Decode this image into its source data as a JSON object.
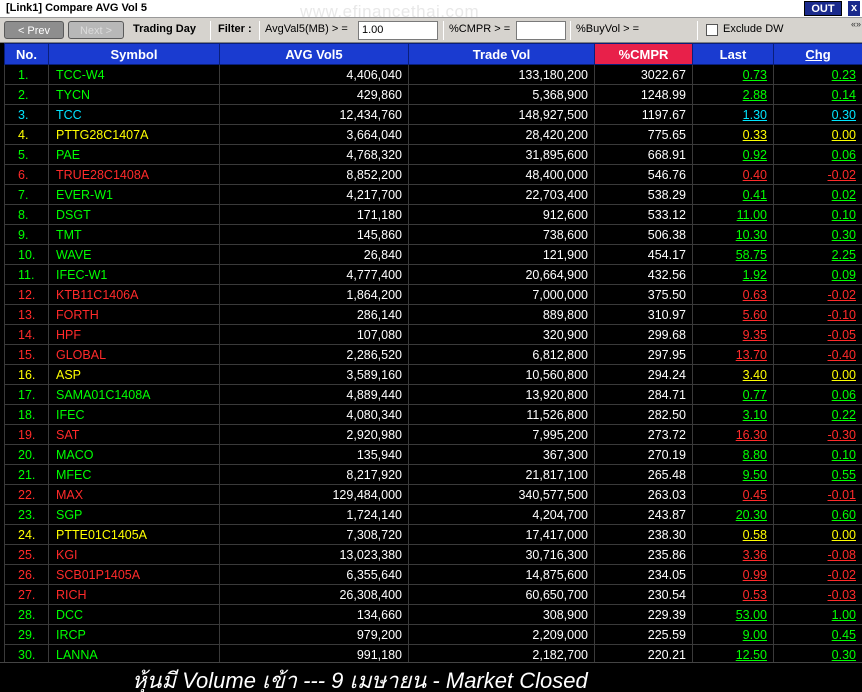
{
  "window": {
    "title": "[Link1] Compare AVG Vol 5",
    "out_label": "OUT",
    "close_label": "x"
  },
  "watermark": "www.efinancethai.com",
  "toolbar": {
    "prev_label": "< Prev",
    "next_label": "Next >",
    "trading_day_label": "Trading Day",
    "filter_label": "Filter :",
    "avgvol_label": "AvgVal5(MB) > =",
    "avgvol_value": "1.00",
    "cmpr_label": "%CMPR > =",
    "cmpr_value": "",
    "buyvol_label": "%BuyVol > =",
    "exclude_dw_label": "Exclude DW",
    "scroll_arrows": "«»"
  },
  "columns": [
    "No.",
    "Symbol",
    "AVG Vol5",
    "Trade Vol",
    "%CMPR",
    "Last",
    "Chg"
  ],
  "colors": {
    "green": "#00ff00",
    "cyan": "#00e5ff",
    "yellow": "#ffff00",
    "red": "#ff2a2a",
    "header_blue": "#1a3bd0",
    "header_highlight": "#e8204a"
  },
  "rows": [
    {
      "no": "1.",
      "symbol": "TCC-W4",
      "avg": "4,406,040",
      "trade": "133,180,200",
      "cmpr": "3022.67",
      "last": "0.73",
      "chg": "0.23",
      "color": "green"
    },
    {
      "no": "2.",
      "symbol": "TYCN",
      "avg": "429,860",
      "trade": "5,368,900",
      "cmpr": "1248.99",
      "last": "2.88",
      "chg": "0.14",
      "color": "green"
    },
    {
      "no": "3.",
      "symbol": "TCC",
      "avg": "12,434,760",
      "trade": "148,927,500",
      "cmpr": "1197.67",
      "last": "1.30",
      "chg": "0.30",
      "color": "cyan"
    },
    {
      "no": "4.",
      "symbol": "PTTG28C1407A",
      "avg": "3,664,040",
      "trade": "28,420,200",
      "cmpr": "775.65",
      "last": "0.33",
      "chg": "0.00",
      "color": "yellow"
    },
    {
      "no": "5.",
      "symbol": "PAE",
      "avg": "4,768,320",
      "trade": "31,895,600",
      "cmpr": "668.91",
      "last": "0.92",
      "chg": "0.06",
      "color": "green"
    },
    {
      "no": "6.",
      "symbol": "TRUE28C1408A",
      "avg": "8,852,200",
      "trade": "48,400,000",
      "cmpr": "546.76",
      "last": "0.40",
      "chg": "-0.02",
      "color": "red"
    },
    {
      "no": "7.",
      "symbol": "EVER-W1",
      "avg": "4,217,700",
      "trade": "22,703,400",
      "cmpr": "538.29",
      "last": "0.41",
      "chg": "0.02",
      "color": "green"
    },
    {
      "no": "8.",
      "symbol": "DSGT",
      "avg": "171,180",
      "trade": "912,600",
      "cmpr": "533.12",
      "last": "11.00",
      "chg": "0.10",
      "color": "green"
    },
    {
      "no": "9.",
      "symbol": "TMT",
      "avg": "145,860",
      "trade": "738,600",
      "cmpr": "506.38",
      "last": "10.30",
      "chg": "0.30",
      "color": "green"
    },
    {
      "no": "10.",
      "symbol": "WAVE",
      "avg": "26,840",
      "trade": "121,900",
      "cmpr": "454.17",
      "last": "58.75",
      "chg": "2.25",
      "color": "green"
    },
    {
      "no": "11.",
      "symbol": "IFEC-W1",
      "avg": "4,777,400",
      "trade": "20,664,900",
      "cmpr": "432.56",
      "last": "1.92",
      "chg": "0.09",
      "color": "green"
    },
    {
      "no": "12.",
      "symbol": "KTB11C1406A",
      "avg": "1,864,200",
      "trade": "7,000,000",
      "cmpr": "375.50",
      "last": "0.63",
      "chg": "-0.02",
      "color": "red"
    },
    {
      "no": "13.",
      "symbol": "FORTH",
      "avg": "286,140",
      "trade": "889,800",
      "cmpr": "310.97",
      "last": "5.60",
      "chg": "-0.10",
      "color": "red"
    },
    {
      "no": "14.",
      "symbol": "HPF",
      "avg": "107,080",
      "trade": "320,900",
      "cmpr": "299.68",
      "last": "9.35",
      "chg": "-0.05",
      "color": "red"
    },
    {
      "no": "15.",
      "symbol": "GLOBAL",
      "avg": "2,286,520",
      "trade": "6,812,800",
      "cmpr": "297.95",
      "last": "13.70",
      "chg": "-0.40",
      "color": "red"
    },
    {
      "no": "16.",
      "symbol": "ASP",
      "avg": "3,589,160",
      "trade": "10,560,800",
      "cmpr": "294.24",
      "last": "3.40",
      "chg": "0.00",
      "color": "yellow"
    },
    {
      "no": "17.",
      "symbol": "SAMA01C1408A",
      "avg": "4,889,440",
      "trade": "13,920,800",
      "cmpr": "284.71",
      "last": "0.77",
      "chg": "0.06",
      "color": "green"
    },
    {
      "no": "18.",
      "symbol": "IFEC",
      "avg": "4,080,340",
      "trade": "11,526,800",
      "cmpr": "282.50",
      "last": "3.10",
      "chg": "0.22",
      "color": "green"
    },
    {
      "no": "19.",
      "symbol": "SAT",
      "avg": "2,920,980",
      "trade": "7,995,200",
      "cmpr": "273.72",
      "last": "16.30",
      "chg": "-0.30",
      "color": "red"
    },
    {
      "no": "20.",
      "symbol": "MACO",
      "avg": "135,940",
      "trade": "367,300",
      "cmpr": "270.19",
      "last": "8.80",
      "chg": "0.10",
      "color": "green"
    },
    {
      "no": "21.",
      "symbol": "MFEC",
      "avg": "8,217,920",
      "trade": "21,817,100",
      "cmpr": "265.48",
      "last": "9.50",
      "chg": "0.55",
      "color": "green"
    },
    {
      "no": "22.",
      "symbol": "MAX",
      "avg": "129,484,000",
      "trade": "340,577,500",
      "cmpr": "263.03",
      "last": "0.45",
      "chg": "-0.01",
      "color": "red"
    },
    {
      "no": "23.",
      "symbol": "SGP",
      "avg": "1,724,140",
      "trade": "4,204,700",
      "cmpr": "243.87",
      "last": "20.30",
      "chg": "0.60",
      "color": "green"
    },
    {
      "no": "24.",
      "symbol": "PTTE01C1405A",
      "avg": "7,308,720",
      "trade": "17,417,000",
      "cmpr": "238.30",
      "last": "0.58",
      "chg": "0.00",
      "color": "yellow"
    },
    {
      "no": "25.",
      "symbol": "KGI",
      "avg": "13,023,380",
      "trade": "30,716,300",
      "cmpr": "235.86",
      "last": "3.36",
      "chg": "-0.08",
      "color": "red"
    },
    {
      "no": "26.",
      "symbol": "SCB01P1405A",
      "avg": "6,355,640",
      "trade": "14,875,600",
      "cmpr": "234.05",
      "last": "0.99",
      "chg": "-0.02",
      "color": "red"
    },
    {
      "no": "27.",
      "symbol": "RICH",
      "avg": "26,308,400",
      "trade": "60,650,700",
      "cmpr": "230.54",
      "last": "0.53",
      "chg": "-0.03",
      "color": "red"
    },
    {
      "no": "28.",
      "symbol": "DCC",
      "avg": "134,660",
      "trade": "308,900",
      "cmpr": "229.39",
      "last": "53.00",
      "chg": "1.00",
      "color": "green"
    },
    {
      "no": "29.",
      "symbol": "IRCP",
      "avg": "979,200",
      "trade": "2,209,000",
      "cmpr": "225.59",
      "last": "9.00",
      "chg": "0.45",
      "color": "green"
    },
    {
      "no": "30.",
      "symbol": "LANNA",
      "avg": "991,180",
      "trade": "2,182,700",
      "cmpr": "220.21",
      "last": "12.50",
      "chg": "0.30",
      "color": "green"
    }
  ],
  "footer": {
    "message": "หุ้นมี Volume เข้า --- 9 เมษายน - Market Closed"
  }
}
